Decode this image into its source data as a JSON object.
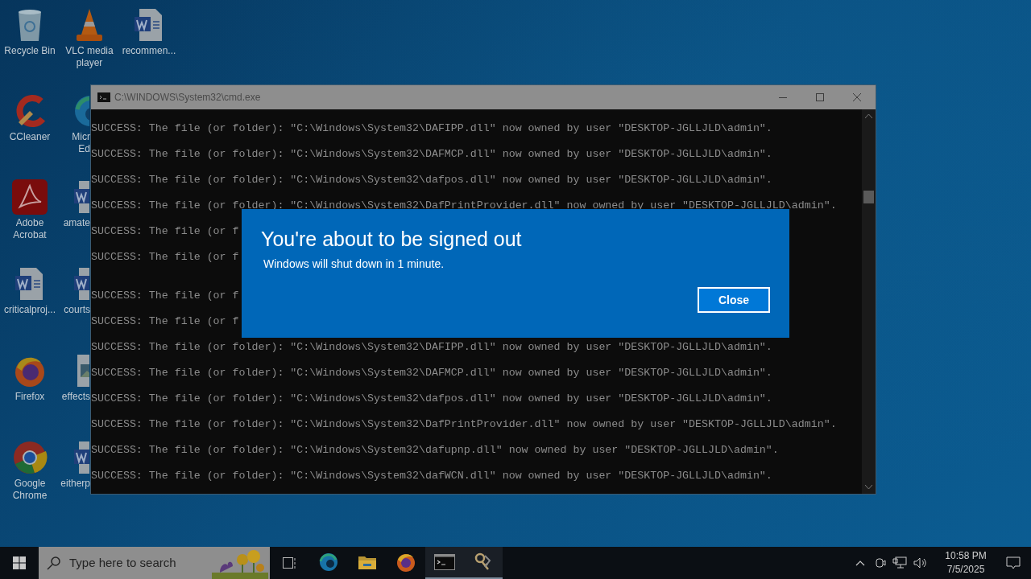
{
  "desktop_columns": [
    [
      {
        "kind": "recycle",
        "lines": [
          "Recycle Bin"
        ]
      },
      {
        "kind": "ccleaner",
        "lines": [
          "CCleaner"
        ]
      },
      {
        "kind": "acrobat",
        "lines": [
          "Adobe",
          "Acrobat"
        ]
      },
      {
        "kind": "word",
        "lines": [
          "criticalproj..."
        ]
      },
      {
        "kind": "firefox",
        "lines": [
          "Firefox"
        ]
      },
      {
        "kind": "chrome",
        "lines": [
          "Google",
          "Chrome"
        ]
      }
    ],
    [
      {
        "kind": "vlc",
        "lines": [
          "VLC media",
          "player"
        ]
      },
      {
        "kind": "edge",
        "lines": [
          "Micr",
          "Ed"
        ]
      },
      {
        "kind": "word",
        "lines": [
          "amate"
        ]
      },
      {
        "kind": "word",
        "lines": [
          "courts"
        ]
      },
      {
        "kind": "image",
        "lines": [
          "effects"
        ]
      },
      {
        "kind": "word",
        "lines": [
          "eitherp"
        ]
      }
    ],
    [
      {
        "kind": "word",
        "lines": [
          "recommen..."
        ]
      }
    ]
  ],
  "console_window": {
    "title": "C:\\WINDOWS\\System32\\cmd.exe",
    "lines": [
      {
        "kind": "text",
        "text": "SUCCESS: The file (or folder): \"C:\\Windows\\System32\\DAFIPP.dll\" now owned by user \"DESKTOP-JGLLJLD\\admin\"."
      },
      {
        "kind": "text",
        "text": "SUCCESS: The file (or folder): \"C:\\Windows\\System32\\DAFMCP.dll\" now owned by user \"DESKTOP-JGLLJLD\\admin\"."
      },
      {
        "kind": "text",
        "text": "SUCCESS: The file (or folder): \"C:\\Windows\\System32\\dafpos.dll\" now owned by user \"DESKTOP-JGLLJLD\\admin\"."
      },
      {
        "kind": "text",
        "text": "SUCCESS: The file (or folder): \"C:\\Windows\\System32\\DafPrintProvider.dll\" now owned by user \"DESKTOP-JGLLJLD\\admin\"."
      },
      {
        "kind": "text",
        "text": "SUCCESS: The file (or f"
      },
      {
        "kind": "text",
        "text": "SUCCESS: The file (or f"
      },
      {
        "kind": "blank"
      },
      {
        "kind": "text",
        "text": "SUCCESS: The file (or f"
      },
      {
        "kind": "text",
        "text": "SUCCESS: The file (or f"
      },
      {
        "kind": "text",
        "text": "SUCCESS: The file (or folder): \"C:\\Windows\\System32\\DAFIPP.dll\" now owned by user \"DESKTOP-JGLLJLD\\admin\"."
      },
      {
        "kind": "text",
        "text": "SUCCESS: The file (or folder): \"C:\\Windows\\System32\\DAFMCP.dll\" now owned by user \"DESKTOP-JGLLJLD\\admin\"."
      },
      {
        "kind": "text",
        "text": "SUCCESS: The file (or folder): \"C:\\Windows\\System32\\dafpos.dll\" now owned by user \"DESKTOP-JGLLJLD\\admin\"."
      },
      {
        "kind": "text",
        "text": "SUCCESS: The file (or folder): \"C:\\Windows\\System32\\DafPrintProvider.dll\" now owned by user \"DESKTOP-JGLLJLD\\admin\"."
      },
      {
        "kind": "text",
        "text": "SUCCESS: The file (or folder): \"C:\\Windows\\System32\\dafupnp.dll\" now owned by user \"DESKTOP-JGLLJLD\\admin\"."
      },
      {
        "kind": "text",
        "text": "SUCCESS: The file (or folder): \"C:\\Windows\\System32\\dafWCN.dll\" now owned by user \"DESKTOP-JGLLJLD\\admin\"."
      }
    ]
  },
  "dialog": {
    "title": "You're about to be signed out",
    "message": "Windows will shut down in 1 minute.",
    "button": "Close"
  },
  "taskbar": {
    "search": {
      "placeholder": "Type here to search"
    },
    "apps": [
      {
        "kind": "edge",
        "running": false
      },
      {
        "kind": "folder",
        "running": false
      },
      {
        "kind": "firefox",
        "running": false
      },
      {
        "kind": "console",
        "running": true
      },
      {
        "kind": "keys",
        "running": true
      }
    ],
    "time": "10:58 PM",
    "date": "7/5/2025"
  }
}
